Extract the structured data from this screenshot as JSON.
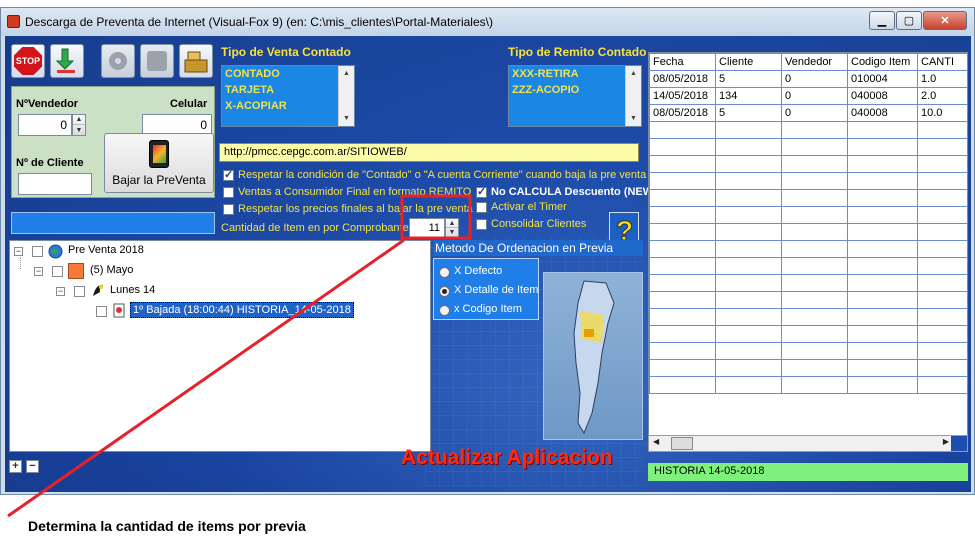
{
  "window": {
    "title": "Descarga de Preventa de Internet (Visual-Fox 9) (en: C:\\mis_clientes\\Portal-Materiales\\)",
    "min_glyph": "▁",
    "max_glyph": "▢",
    "close_glyph": "✕"
  },
  "toolbar": {
    "stop_label": "STOP",
    "buttons": [
      "stop-icon",
      "download-arrow-icon",
      "gear-icon",
      "blank-icon",
      "cash-register-icon"
    ]
  },
  "left_panel": {
    "vendedor_label": "NºVendedor",
    "vendedor_value": "0",
    "celular_label": "Celular",
    "celular_value": "0",
    "cliente_label": "Nº de Cliente",
    "cliente_value": "",
    "bajar_label": "Bajar la PreVenta"
  },
  "tipo_venta": {
    "header": "Tipo de Venta Contado",
    "items": [
      "CONTADO",
      "TARJETA",
      "X-ACOPIAR"
    ]
  },
  "tipo_remito": {
    "header": "Tipo de Remito Contado",
    "items": [
      "XXX-RETIRA",
      "ZZZ-ACOPIO"
    ]
  },
  "url": "http://pmcc.cepgc.com.ar/SITIOWEB/",
  "options": {
    "respetar_contado": "Respetar la condición de \"Contado\" o \"A cuenta Corriente\" cuando baja la pre venta",
    "ventas_consumidor": "Ventas a Consumidor Final  en formato REMITO",
    "no_calcula": "No CALCULA Descuento (NEW)",
    "respetar_precios": "Respetar los precios finales al bajar la pre venta",
    "activar_timer": "Activar el Timer",
    "cantidad_label": "Cantidad de Item en por Comprobante",
    "cantidad_value": "11",
    "consolidar": "Consolidar Clientes"
  },
  "tree": {
    "root": "Pre Venta 2018",
    "month": "(5) Mayo",
    "day": "Lunes 14",
    "entry": "1º  Bajada (18:00:44) HISTORIA_14-05-2018"
  },
  "sort": {
    "header": "Metodo De Ordenacion en Previa",
    "options": [
      "X Defecto",
      "X Detalle de Item",
      "x Codigo Item"
    ],
    "selected": 1
  },
  "actualizar_label": "Actualizar Aplicacion",
  "plus_label": "+",
  "minus_label": "−",
  "grid": {
    "columns": [
      "Fecha",
      "Cliente",
      "Vendedor",
      "Codigo Item",
      "CANTI"
    ],
    "rows": [
      [
        "08/05/2018",
        "5",
        "0",
        "010004",
        "1.0"
      ],
      [
        "14/05/2018",
        "134",
        "0",
        "040008",
        "2.0"
      ],
      [
        "08/05/2018",
        "5",
        "0",
        "040008",
        "10.0"
      ]
    ],
    "status": "HISTORIA  14-05-2018"
  },
  "annotation": {
    "caption": "Determina la cantidad de items por previa",
    "color": "#e8202a"
  }
}
